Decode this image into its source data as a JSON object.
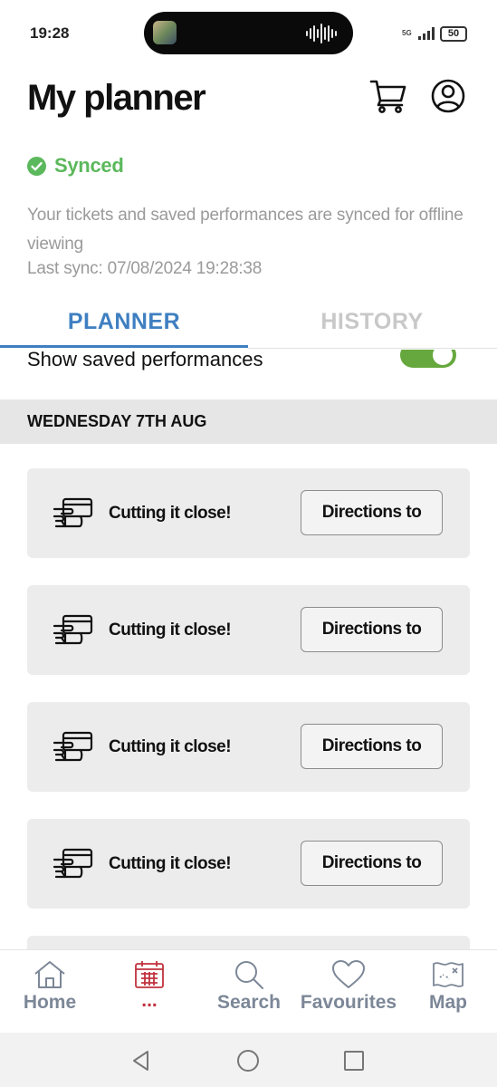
{
  "status_bar": {
    "time": "19:28",
    "network": "5G",
    "battery": "50"
  },
  "header": {
    "title": "My planner",
    "icons": [
      "cart-icon",
      "profile-icon"
    ]
  },
  "sync": {
    "status": "Synced",
    "description": "Your tickets and saved performances are synced for offline viewing",
    "last_sync": "Last sync: 07/08/2024 19:28:38"
  },
  "tabs": [
    {
      "label": "PLANNER",
      "active": true
    },
    {
      "label": "HISTORY",
      "active": false
    }
  ],
  "toggle": {
    "label": "Show saved performances",
    "on": true
  },
  "day_header": "WEDNESDAY 7TH AUG",
  "cards": [
    {
      "title": "Cutting it close!",
      "button": "Directions to"
    },
    {
      "title": "Cutting it close!",
      "button": "Directions to"
    },
    {
      "title": "Cutting it close!",
      "button": "Directions to"
    },
    {
      "title": "Cutting it close!",
      "button": "Directions to"
    }
  ],
  "bottom_nav": [
    {
      "label": "Home",
      "icon": "home-icon"
    },
    {
      "label": "...",
      "icon": "calendar-icon",
      "active": true
    },
    {
      "label": "Search",
      "icon": "search-icon"
    },
    {
      "label": "Favourites",
      "icon": "heart-icon"
    },
    {
      "label": "Map",
      "icon": "map-icon"
    }
  ],
  "colors": {
    "accent": "#3f7fc1",
    "synced": "#5cb85c",
    "toggle": "#66a83d",
    "nav_active": "#c0323e",
    "nav_inactive": "#7c8797"
  }
}
